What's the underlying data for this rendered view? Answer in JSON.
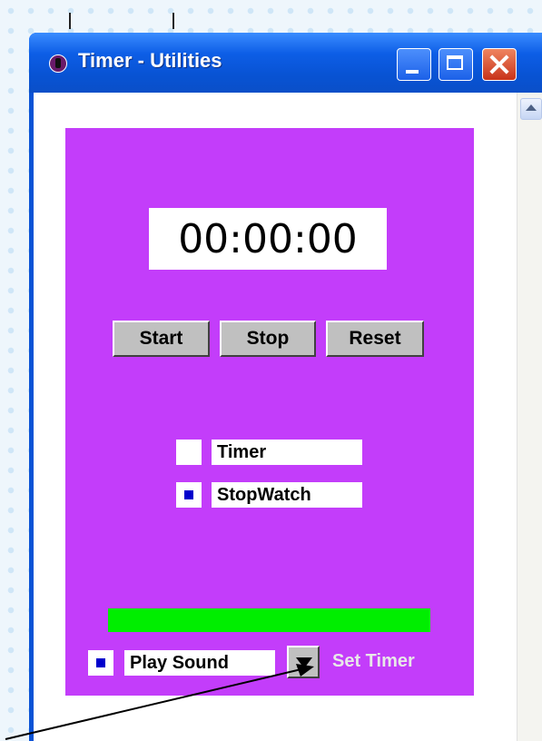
{
  "window": {
    "title": "Timer - Utilities",
    "titlebar_buttons": [
      "minimize-icon",
      "maximize-icon",
      "close-icon"
    ]
  },
  "timer_panel": {
    "display": "00:00:00",
    "buttons": {
      "start_label": "Start",
      "stop_label": "Stop",
      "reset_label": "Reset"
    },
    "mode_options": [
      {
        "label": "Timer",
        "checked": false
      },
      {
        "label": "StopWatch",
        "checked": true
      }
    ],
    "progress": 1.0,
    "play_sound": {
      "label": "Play Sound",
      "checked": true
    },
    "set_timer_label": "Set Timer"
  },
  "colors": {
    "panel": "#c33dfa",
    "progress": "#00ee00",
    "checkbox_mark": "#0000cc",
    "titlebar": "#0a53d6"
  }
}
